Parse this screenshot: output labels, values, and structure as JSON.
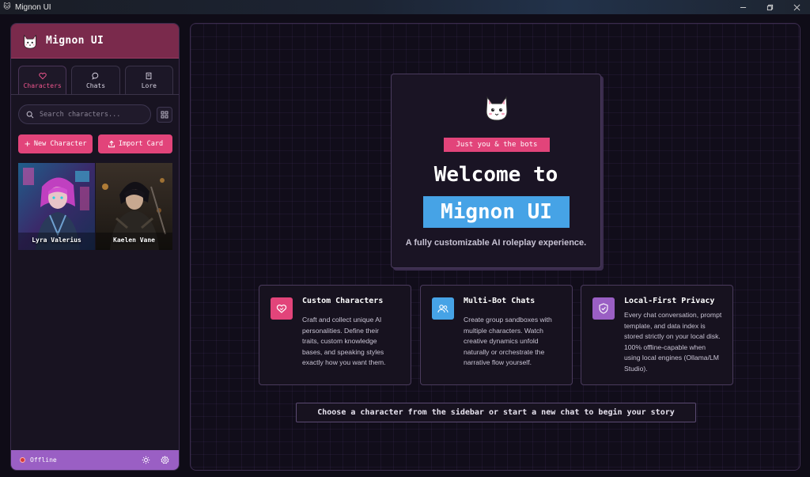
{
  "window": {
    "title": "Mignon UI",
    "controls": [
      "minimize",
      "restore",
      "close"
    ]
  },
  "sidebar": {
    "brand": "Mignon UI",
    "tabs": [
      {
        "label": "Characters",
        "icon": "heart-icon",
        "active": true
      },
      {
        "label": "Chats",
        "icon": "chat-bubble-icon",
        "active": false
      },
      {
        "label": "Lore",
        "icon": "book-icon",
        "active": false
      }
    ],
    "search": {
      "placeholder": "Search characters..."
    },
    "buttons": {
      "new_character": "New Character",
      "import_card": "Import Card"
    },
    "characters": [
      {
        "name": "Lyra Valerius"
      },
      {
        "name": "Kaelen Vane"
      }
    ],
    "footer": {
      "status": "Offline",
      "status_color": "#d43a3a"
    }
  },
  "main": {
    "hero": {
      "tagline": "Just you & the bots",
      "welcome": "Welcome to",
      "app_name": "Mignon UI",
      "subtitle": "A fully customizable AI roleplay experience."
    },
    "features": [
      {
        "title": "Custom Characters",
        "icon": "heart-bubble-icon",
        "color": "#e2447a",
        "description": "Craft and collect unique AI personalities. Define their traits, custom knowledge bases, and speaking styles exactly how you want them."
      },
      {
        "title": "Multi-Bot Chats",
        "icon": "users-icon",
        "color": "#46a3e6",
        "description": "Create group sandboxes with multiple characters. Watch creative dynamics unfold naturally or orchestrate the narrative flow yourself."
      },
      {
        "title": "Local-First Privacy",
        "icon": "shield-check-icon",
        "color": "#9a5fc4",
        "description": "Every chat conversation, prompt template, and data index is stored strictly on your local disk. 100% offline-capable when using local engines (Ollama/LM Studio)."
      }
    ],
    "cta": "Choose a character from the sidebar or start a new chat to begin your story"
  },
  "colors": {
    "accent_pink": "#e2447a",
    "accent_blue": "#46a3e6",
    "accent_purple": "#9a5fc4",
    "header": "#7a2a4c",
    "background": "#110d1a"
  }
}
